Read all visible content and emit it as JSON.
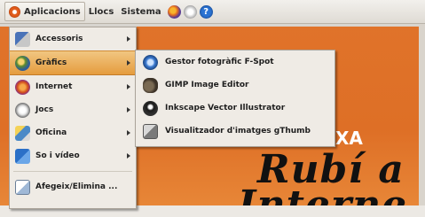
{
  "panel": {
    "menus": [
      {
        "label": "Aplicacions"
      },
      {
        "label": "Llocs"
      },
      {
        "label": "Sistema"
      }
    ],
    "icons": [
      "firefox-icon",
      "mail-icon",
      "help-icon"
    ]
  },
  "applications_menu": {
    "items": [
      {
        "label": "Accessoris",
        "icon": "accessories-icon"
      },
      {
        "label": "Gràfics",
        "icon": "graphics-icon"
      },
      {
        "label": "Internet",
        "icon": "internet-icon"
      },
      {
        "label": "Jocs",
        "icon": "games-icon"
      },
      {
        "label": "Oficina",
        "icon": "office-icon"
      },
      {
        "label": "So i vídeo",
        "icon": "sound-video-icon"
      }
    ],
    "footer_item": {
      "label": "Afegeix/Elimina ...",
      "icon": "add-remove-icon"
    }
  },
  "graphics_submenu": {
    "items": [
      {
        "label": "Gestor fotogràfic F-Spot",
        "icon": "f-spot-icon"
      },
      {
        "label": "GIMP Image Editor",
        "icon": "gimp-icon"
      },
      {
        "label": "Inkscape Vector Illustrator",
        "icon": "inkscape-icon"
      },
      {
        "label": "Visualitzador d'imatges gThumb",
        "icon": "gthumb-icon"
      }
    ]
  },
  "wallpaper": {
    "line1": "Rubí a",
    "line2": "Interne",
    "small": "XA"
  },
  "colors": {
    "wallpaper_orange": "#e0732a",
    "menu_highlight": "#e59c3e",
    "panel_bg": "#e8e5e0"
  }
}
